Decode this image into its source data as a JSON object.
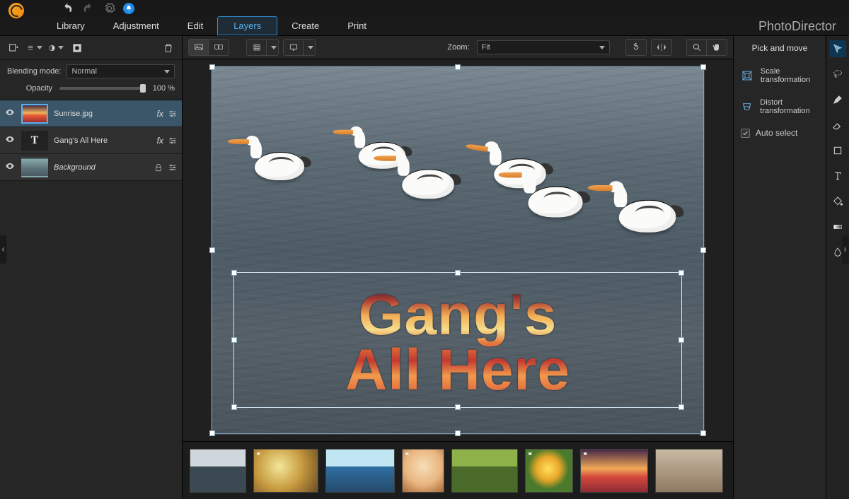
{
  "brand": "PhotoDirector",
  "tabs": [
    "Library",
    "Adjustment",
    "Edit",
    "Layers",
    "Create",
    "Print"
  ],
  "active_tab": "Layers",
  "left": {
    "blend_label": "Blending mode:",
    "blend_value": "Normal",
    "opacity_label": "Opacity",
    "opacity_value": "100 %"
  },
  "layers": [
    {
      "name": "Sunrise.jpg",
      "type": "image",
      "selected": true,
      "fx": true,
      "locked": false
    },
    {
      "name": "Gang's All Here",
      "type": "text",
      "selected": false,
      "fx": true,
      "locked": false
    },
    {
      "name": "Background",
      "type": "image",
      "selected": false,
      "fx": false,
      "locked": true,
      "italic": true
    }
  ],
  "canvas": {
    "text_line1": "Gang's",
    "text_line2": "All Here"
  },
  "toolbar": {
    "zoom_label": "Zoom:",
    "zoom_value": "Fit"
  },
  "right": {
    "title": "Pick and move",
    "scale": "Scale transformation",
    "distort": "Distort transformation",
    "autoselect": "Auto select"
  },
  "thumbnails": [
    {
      "style": "background:linear-gradient(180deg,#cfd7dc 40%,#3b4a52 40%);width:80px;"
    },
    {
      "style": "background:radial-gradient(circle at 40% 40%,#f3e79a,#c79a3f 50%,#6a4d23);width:92px;",
      "flag": true
    },
    {
      "style": "background:linear-gradient(180deg,#bfe6f2 40%,#2f6fa2 40%,#254a6c);width:98px;"
    },
    {
      "style": "background:radial-gradient(circle at 50% 40%,#f6deb8,#e9b680 55%,#a76a3a);width:60px;",
      "flag": true
    },
    {
      "style": "background:linear-gradient(180deg,#8fb14a 40%,#4a6a2a 40%);width:94px;"
    },
    {
      "style": "background:radial-gradient(circle at 48% 45%,#ffe15c,#e8a628 35%,#4c7a2c 60%);width:68px;",
      "flag": true
    },
    {
      "style": "background:linear-gradient(180deg,#472846 0%,#f2a856 45%,#d4483c 65%,#8e2c35 100%);width:96px;",
      "flag": true
    },
    {
      "style": "background:linear-gradient(180deg,#c9b9a3,#8f7a63);width:96px;"
    }
  ]
}
